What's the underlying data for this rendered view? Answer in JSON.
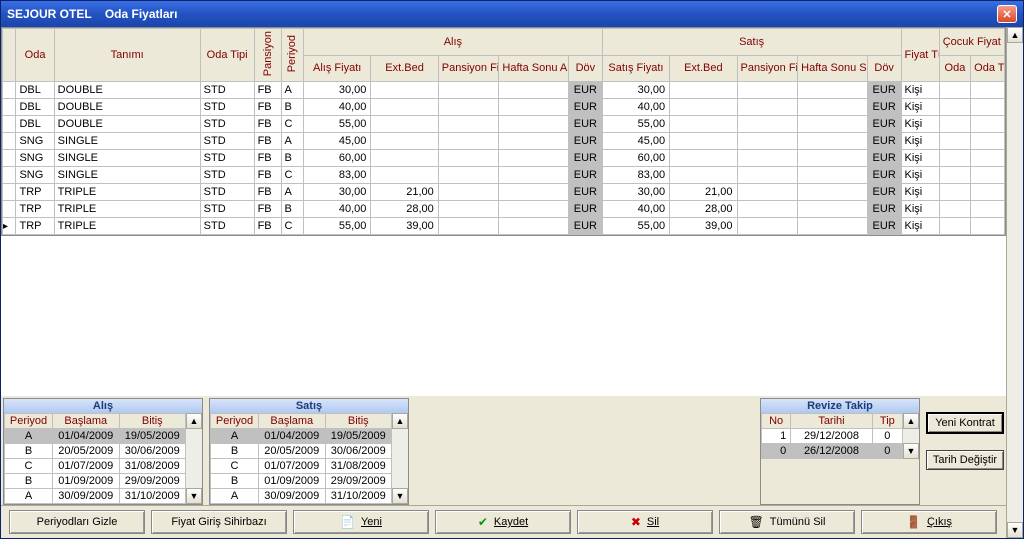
{
  "title_bar": {
    "app": "SEJOUR OTEL",
    "screen": "Oda Fiyatları"
  },
  "grid": {
    "headers": {
      "oda": "Oda",
      "tanimi": "Tanımı",
      "oda_tipi": "Oda Tipi",
      "pansiyon": "Pansiyon",
      "periyod": "Periyod",
      "alis_group": "Alış",
      "satis_group": "Satış",
      "fiyat_turu": "Fiyat Türü",
      "cocuk_group": "Çocuk Fiyat Referans",
      "alis_fiyati": "Alış Fiyatı",
      "ext_bed": "Ext.Bed",
      "pansiyon_fiyati": "Pansiyon Fiyatı",
      "hafta_sonu_alis": "Hafta Sonu Alış Fiyatı",
      "dov": "Döv",
      "satis_fiyati": "Satış Fiyatı",
      "hafta_sonu_satis": "Hafta Sonu Satış Fiyatı",
      "cocuk_oda": "Oda",
      "cocuk_oda_tipi": "Oda Tipi"
    },
    "rows": [
      {
        "oda": "DBL",
        "tanimi": "DOUBLE",
        "oda_tipi": "STD",
        "pansiyon": "FB",
        "periyod": "A",
        "alis": "30,00",
        "alis_ext": "",
        "alis_pf": "",
        "alis_hs": "",
        "alis_dov": "EUR",
        "satis": "30,00",
        "satis_ext": "",
        "satis_pf": "",
        "satis_hs": "",
        "satis_dov": "EUR",
        "turu": "Kişi",
        "cok_oda": "",
        "cok_oda_tipi": ""
      },
      {
        "oda": "DBL",
        "tanimi": "DOUBLE",
        "oda_tipi": "STD",
        "pansiyon": "FB",
        "periyod": "B",
        "alis": "40,00",
        "alis_ext": "",
        "alis_pf": "",
        "alis_hs": "",
        "alis_dov": "EUR",
        "satis": "40,00",
        "satis_ext": "",
        "satis_pf": "",
        "satis_hs": "",
        "satis_dov": "EUR",
        "turu": "Kişi",
        "cok_oda": "",
        "cok_oda_tipi": ""
      },
      {
        "oda": "DBL",
        "tanimi": "DOUBLE",
        "oda_tipi": "STD",
        "pansiyon": "FB",
        "periyod": "C",
        "alis": "55,00",
        "alis_ext": "",
        "alis_pf": "",
        "alis_hs": "",
        "alis_dov": "EUR",
        "satis": "55,00",
        "satis_ext": "",
        "satis_pf": "",
        "satis_hs": "",
        "satis_dov": "EUR",
        "turu": "Kişi",
        "cok_oda": "",
        "cok_oda_tipi": ""
      },
      {
        "oda": "SNG",
        "tanimi": "SINGLE",
        "oda_tipi": "STD",
        "pansiyon": "FB",
        "periyod": "A",
        "alis": "45,00",
        "alis_ext": "",
        "alis_pf": "",
        "alis_hs": "",
        "alis_dov": "EUR",
        "satis": "45,00",
        "satis_ext": "",
        "satis_pf": "",
        "satis_hs": "",
        "satis_dov": "EUR",
        "turu": "Kişi",
        "cok_oda": "",
        "cok_oda_tipi": ""
      },
      {
        "oda": "SNG",
        "tanimi": "SINGLE",
        "oda_tipi": "STD",
        "pansiyon": "FB",
        "periyod": "B",
        "alis": "60,00",
        "alis_ext": "",
        "alis_pf": "",
        "alis_hs": "",
        "alis_dov": "EUR",
        "satis": "60,00",
        "satis_ext": "",
        "satis_pf": "",
        "satis_hs": "",
        "satis_dov": "EUR",
        "turu": "Kişi",
        "cok_oda": "",
        "cok_oda_tipi": ""
      },
      {
        "oda": "SNG",
        "tanimi": "SINGLE",
        "oda_tipi": "STD",
        "pansiyon": "FB",
        "periyod": "C",
        "alis": "83,00",
        "alis_ext": "",
        "alis_pf": "",
        "alis_hs": "",
        "alis_dov": "EUR",
        "satis": "83,00",
        "satis_ext": "",
        "satis_pf": "",
        "satis_hs": "",
        "satis_dov": "EUR",
        "turu": "Kişi",
        "cok_oda": "",
        "cok_oda_tipi": ""
      },
      {
        "oda": "TRP",
        "tanimi": "TRIPLE",
        "oda_tipi": "STD",
        "pansiyon": "FB",
        "periyod": "A",
        "alis": "30,00",
        "alis_ext": "21,00",
        "alis_pf": "",
        "alis_hs": "",
        "alis_dov": "EUR",
        "satis": "30,00",
        "satis_ext": "21,00",
        "satis_pf": "",
        "satis_hs": "",
        "satis_dov": "EUR",
        "turu": "Kişi",
        "cok_oda": "",
        "cok_oda_tipi": ""
      },
      {
        "oda": "TRP",
        "tanimi": "TRIPLE",
        "oda_tipi": "STD",
        "pansiyon": "FB",
        "periyod": "B",
        "alis": "40,00",
        "alis_ext": "28,00",
        "alis_pf": "",
        "alis_hs": "",
        "alis_dov": "EUR",
        "satis": "40,00",
        "satis_ext": "28,00",
        "satis_pf": "",
        "satis_hs": "",
        "satis_dov": "EUR",
        "turu": "Kişi",
        "cok_oda": "",
        "cok_oda_tipi": ""
      },
      {
        "oda": "TRP",
        "tanimi": "TRIPLE",
        "oda_tipi": "STD",
        "pansiyon": "FB",
        "periyod": "C",
        "alis": "55,00",
        "alis_ext": "39,00",
        "alis_pf": "",
        "alis_hs": "",
        "alis_dov": "EUR",
        "satis": "55,00",
        "satis_ext": "39,00",
        "satis_pf": "",
        "satis_hs": "",
        "satis_dov": "EUR",
        "turu": "Kişi",
        "cok_oda": "",
        "cok_oda_tipi": "",
        "marker": true
      }
    ]
  },
  "periods_alis": {
    "title": "Alış",
    "headers": {
      "periyod": "Periyod",
      "baslama": "Başlama",
      "bitis": "Bitiş"
    },
    "rows": [
      {
        "p": "A",
        "b": "01/04/2009",
        "e": "19/05/2009",
        "sel": true
      },
      {
        "p": "B",
        "b": "20/05/2009",
        "e": "30/06/2009"
      },
      {
        "p": "C",
        "b": "01/07/2009",
        "e": "31/08/2009"
      },
      {
        "p": "B",
        "b": "01/09/2009",
        "e": "29/09/2009"
      },
      {
        "p": "A",
        "b": "30/09/2009",
        "e": "31/10/2009"
      }
    ]
  },
  "periods_satis": {
    "title": "Satış",
    "headers": {
      "periyod": "Periyod",
      "baslama": "Başlama",
      "bitis": "Bitiş"
    },
    "rows": [
      {
        "p": "A",
        "b": "01/04/2009",
        "e": "19/05/2009",
        "sel": true
      },
      {
        "p": "B",
        "b": "20/05/2009",
        "e": "30/06/2009"
      },
      {
        "p": "C",
        "b": "01/07/2009",
        "e": "31/08/2009"
      },
      {
        "p": "B",
        "b": "01/09/2009",
        "e": "29/09/2009"
      },
      {
        "p": "A",
        "b": "30/09/2009",
        "e": "31/10/2009"
      }
    ]
  },
  "revize": {
    "title": "Revize Takip",
    "headers": {
      "no": "No",
      "tarihi": "Tarihi",
      "tip": "Tip"
    },
    "rows": [
      {
        "no": "1",
        "t": "29/12/2008",
        "tip": "0"
      },
      {
        "no": "0",
        "t": "26/12/2008",
        "tip": "0",
        "sel": true
      }
    ],
    "buttons": {
      "yeni_kontrat": "Yeni Kontrat",
      "tarih_degistir": "Tarih Değiştir"
    }
  },
  "toolbar": {
    "periyod_gizle": "Periyodları Gizle",
    "fiyat_sihirbaz": "Fiyat Giriş Sihirbazı",
    "yeni": "Yeni",
    "kaydet": "Kaydet",
    "sil": "Sil",
    "tumunu_sil": "Tümünü Sil",
    "cikis": "Çıkış"
  }
}
